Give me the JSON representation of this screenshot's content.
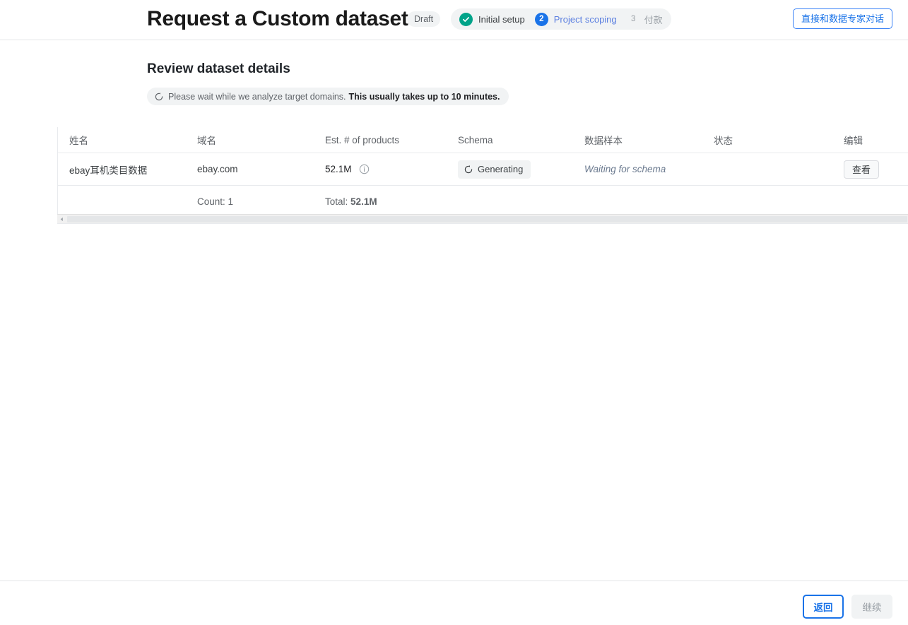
{
  "header": {
    "title": "Request a Custom dataset",
    "status_badge": "Draft",
    "expert_button": "直接和数据专家对话",
    "steps": [
      {
        "marker": "✓",
        "label": "Initial setup",
        "state": "done"
      },
      {
        "marker": "2",
        "label": "Project scoping",
        "state": "active"
      },
      {
        "marker": "3",
        "label": "付款",
        "state": "todo"
      }
    ],
    "colors": {
      "done": "#00a389",
      "active": "#1a73e8",
      "todo": "#9aa0a6",
      "link": "#1a73e8"
    }
  },
  "main": {
    "section_title": "Review dataset details",
    "notice": {
      "icon": "spinner-icon",
      "text": "Please wait while we analyze target domains.",
      "emphasis": "This usually takes up to 10 minutes."
    },
    "table": {
      "columns": [
        "姓名",
        "域名",
        "Est. # of products",
        "Schema",
        "数据样本",
        "状态",
        "编辑"
      ],
      "rows": [
        {
          "name": "ebay耳机类目数据",
          "domain": "ebay.com",
          "est_products": "52.1M",
          "est_info_icon": "info-icon",
          "schema": "Generating",
          "schema_icon": "spinner-icon",
          "sample": "Waiting for schema",
          "status": "",
          "edit_button": "查看"
        }
      ],
      "footer": {
        "count_label": "Count: 1",
        "total_label": "Total:",
        "total_value": "52.1M"
      }
    }
  },
  "footer": {
    "back_button": "返回",
    "continue_button": "继续"
  }
}
